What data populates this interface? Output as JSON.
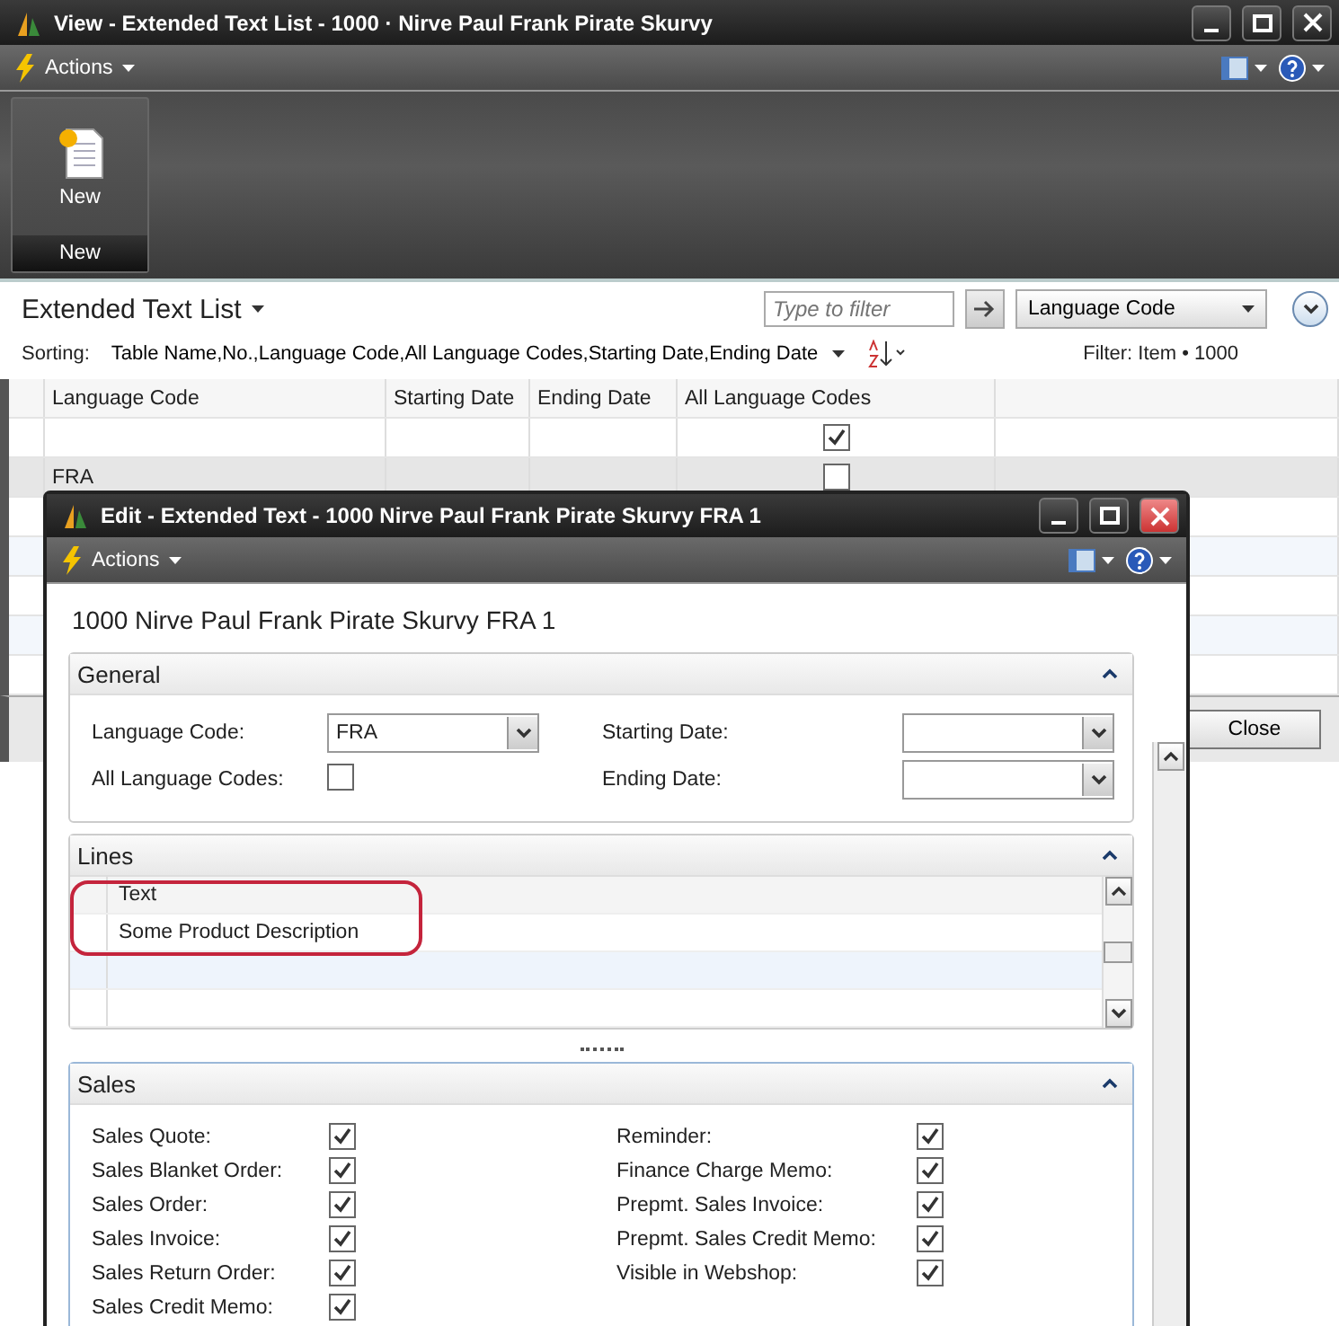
{
  "list_window": {
    "title": "View - Extended Text List - 1000 · Nirve Paul Frank Pirate Skurvy",
    "actions_label": "Actions",
    "ribbon": {
      "button": "New",
      "group": "New"
    },
    "page_title": "Extended Text List",
    "filter": {
      "placeholder": "Type to filter",
      "field": "Language Code"
    },
    "sorting_label": "Sorting:",
    "sorting": "Table Name,No.,Language Code,All Language Codes,Starting Date,Ending Date",
    "filter_text": "Filter: Item • 1000",
    "columns": [
      "Language Code",
      "Starting Date",
      "Ending Date",
      "All Language Codes"
    ],
    "rows": [
      {
        "language_code": "",
        "all_language_codes": true,
        "selected": false
      },
      {
        "language_code": "FRA",
        "all_language_codes": false,
        "selected": true
      }
    ],
    "close_button": "Close"
  },
  "edit_window": {
    "title": "Edit - Extended Text - 1000 Nirve Paul Frank Pirate Skurvy FRA 1",
    "actions_label": "Actions",
    "heading": "1000 Nirve Paul Frank Pirate Skurvy FRA 1",
    "general": {
      "title": "General",
      "fields": [
        {
          "label": "Language Code:",
          "kind": "dropdown",
          "value": "FRA"
        },
        {
          "label": "Starting Date:",
          "kind": "dropdown"
        },
        {
          "label": "All Language Codes:",
          "kind": "checkbox",
          "checked": false
        },
        {
          "label": "Ending Date:",
          "kind": "dropdown"
        }
      ]
    },
    "lines": {
      "title": "Lines",
      "column": "Text",
      "rows": [
        "Some Product Description"
      ]
    },
    "sales": {
      "title": "Sales",
      "left": [
        {
          "label": "Sales Quote:",
          "checked": true
        },
        {
          "label": "Sales Blanket Order:",
          "checked": true
        },
        {
          "label": "Sales Order:",
          "checked": true
        },
        {
          "label": "Sales Invoice:",
          "checked": true
        },
        {
          "label": "Sales Return Order:",
          "checked": true
        },
        {
          "label": "Sales Credit Memo:",
          "checked": true
        }
      ],
      "right": [
        {
          "label": "Reminder:",
          "checked": true
        },
        {
          "label": "Finance Charge Memo:",
          "checked": true
        },
        {
          "label": "Prepmt. Sales Invoice:",
          "checked": true
        },
        {
          "label": "Prepmt. Sales Credit Memo:",
          "checked": true
        },
        {
          "label": "Visible in Webshop:",
          "checked": true
        }
      ]
    }
  }
}
